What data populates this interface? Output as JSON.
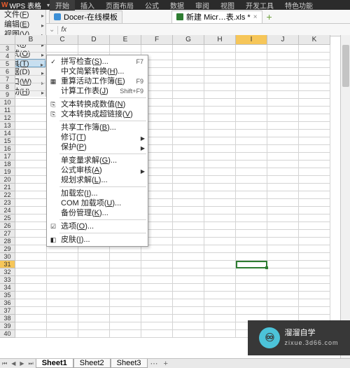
{
  "ribbon": {
    "logo": "W",
    "name": "WPS 表格",
    "tabs": [
      "开始",
      "插入",
      "页面布局",
      "公式",
      "数据",
      "审阅",
      "视图",
      "开发工具",
      "特色功能"
    ]
  },
  "filetabs": {
    "docer": "Docer-在线模板",
    "file": "新建 Micr…表.xls *"
  },
  "formulabar": {
    "fx": "fx"
  },
  "leftmenu": {
    "items": [
      {
        "label": "文件",
        "key": "F"
      },
      {
        "label": "编辑",
        "key": "E"
      },
      {
        "label": "视图",
        "key": "V"
      },
      {
        "label": "插入",
        "key": "I"
      },
      {
        "label": "格式",
        "key": "O"
      },
      {
        "label": "工具",
        "key": "T",
        "active": true
      },
      {
        "label": "数据",
        "key": "D"
      },
      {
        "label": "窗口",
        "key": "W"
      },
      {
        "label": "帮助",
        "key": "H"
      }
    ]
  },
  "submenu": {
    "items": [
      {
        "label": "拼写检查",
        "key": "S",
        "after": "...",
        "sc": "F7",
        "icon": "✓"
      },
      {
        "label": "中文简繁转换",
        "key": "H",
        "after": "..."
      },
      {
        "label": "重算活动工作簿",
        "key": "E",
        "sc": "F9",
        "icon": "▦"
      },
      {
        "label": "计算工作表",
        "key": "J",
        "sc": "Shift+F9"
      },
      {
        "sep": true
      },
      {
        "label": "文本转换成数值",
        "key": "N",
        "icon": "⎘"
      },
      {
        "label": "文本转换成超链接",
        "key": "V",
        "icon": "⎘"
      },
      {
        "sep": true
      },
      {
        "label": "共享工作簿",
        "key": "B",
        "after": "..."
      },
      {
        "label": "修订",
        "key": "T",
        "arrow": true
      },
      {
        "label": "保护",
        "key": "P",
        "arrow": true
      },
      {
        "sep": true
      },
      {
        "label": "单变量求解",
        "key": "G",
        "after": "..."
      },
      {
        "label": "公式审核",
        "key": "A",
        "arrow": true
      },
      {
        "label": "规划求解",
        "key": "L",
        "after": "..."
      },
      {
        "sep": true
      },
      {
        "label": "加载宏",
        "key": "I",
        "after": "..."
      },
      {
        "label": "COM 加载项",
        "key": "U",
        "after": "..."
      },
      {
        "label": "备份管理",
        "key": "K",
        "after": "..."
      },
      {
        "sep": true
      },
      {
        "label": "选项",
        "key": "O",
        "after": "...",
        "icon": "☑"
      },
      {
        "sep": true
      },
      {
        "label": "皮肤",
        "key": "I",
        "after": "...",
        "icon": "◧"
      }
    ]
  },
  "grid": {
    "cols": [
      "B",
      "C",
      "D",
      "E",
      "F",
      "G",
      "H",
      "I",
      "J",
      "K"
    ],
    "activeCol": "I",
    "rowStart": 3,
    "rowEnd": 40,
    "activeRow": 31
  },
  "sheets": {
    "tabs": [
      "Sheet1",
      "Sheet2",
      "Sheet3"
    ],
    "active": 0
  },
  "watermark": {
    "brand": "溜溜自学",
    "sub": "zixue.3d66.com"
  }
}
